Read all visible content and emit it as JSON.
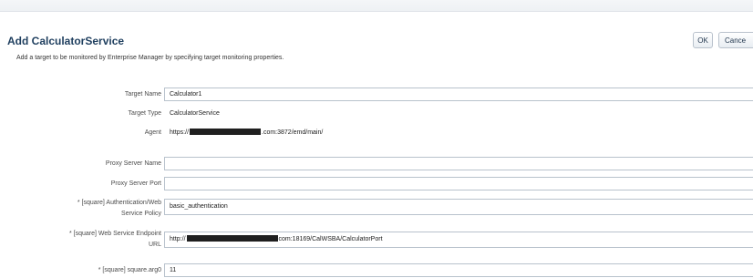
{
  "header": {
    "title": "Add CalculatorService",
    "subtitle": "Add a target to be monitored by Enterprise Manager by specifying target monitoring properties.",
    "ok_label": "OK",
    "cancel_label": "Cance"
  },
  "form": {
    "target_name": {
      "label": "Target Name",
      "value": "Calculator1"
    },
    "target_type": {
      "label": "Target Type",
      "value": "CalculatorService"
    },
    "agent": {
      "label": "Agent",
      "value_prefix": "https://",
      "value_suffix": ".com:3872/emd/main/"
    },
    "proxy_server_name": {
      "label": "Proxy Server Name",
      "value": ""
    },
    "proxy_server_port": {
      "label": "Proxy Server Port",
      "value": ""
    },
    "auth_policy": {
      "label_line1": "* [square] Authentication/Web",
      "label_line2": "Service Policy",
      "value": "basic_authentication"
    },
    "endpoint_url": {
      "label_line1": "* [square] Web Service Endpoint",
      "label_line2": "URL",
      "value_prefix": "http://",
      "value_suffix": "com:18169/CalWSBA/CalculatorPort"
    },
    "arg0": {
      "label": "* [square] square.arg0",
      "value": "11"
    }
  }
}
